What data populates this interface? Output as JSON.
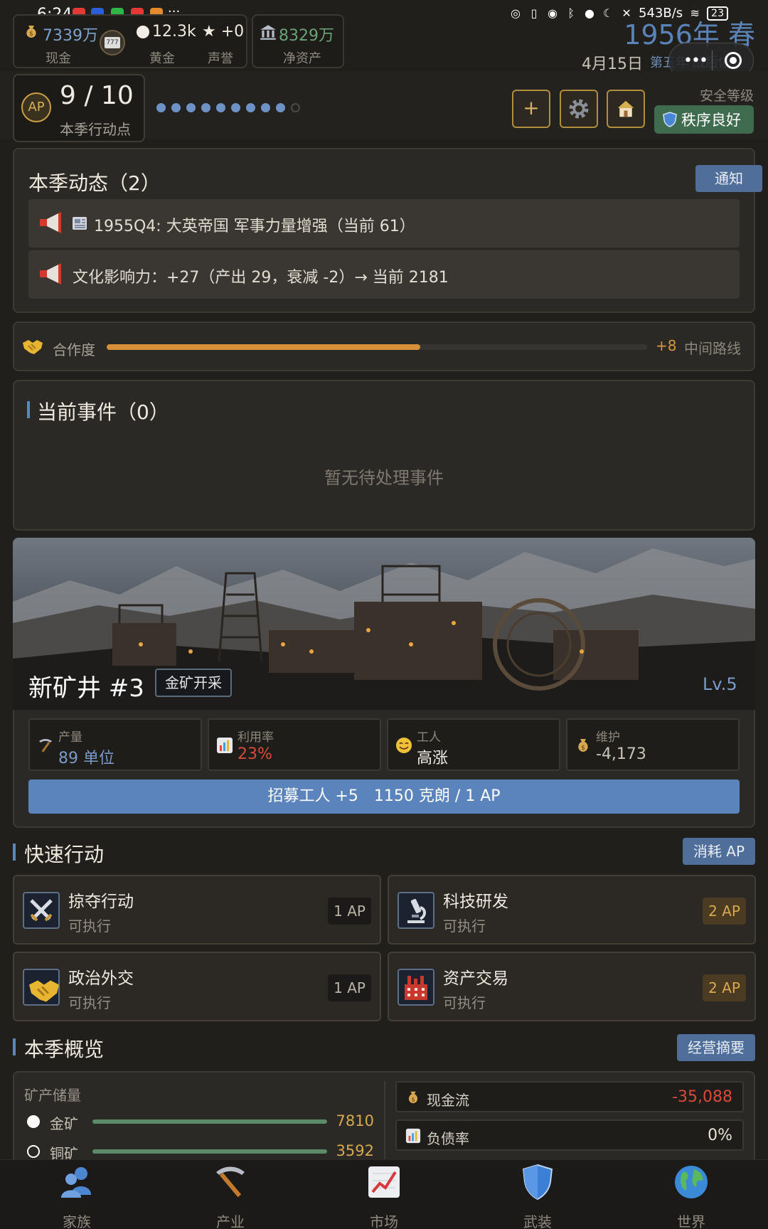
{
  "status_bar": {
    "time": "6:24",
    "net_speed": "543B/s",
    "battery": "23",
    "more": "···"
  },
  "resources": {
    "cash": {
      "value": "7339万",
      "label": "现金",
      "icon": "money-bag-icon"
    },
    "gold": {
      "value": "12.3k",
      "label": "黄金"
    },
    "prestige": {
      "value": "★ +0",
      "label": "声誉"
    },
    "net_assets": {
      "value": "8329万",
      "label": "净资产",
      "icon": "bank-icon"
    }
  },
  "date": {
    "year_season": "1956年 春",
    "day": "4月15日",
    "era": "第五年 战后恢"
  },
  "action_points": {
    "badge": "AP",
    "value": "9 / 10",
    "label": "本季行动点",
    "filled": 9,
    "total": 10
  },
  "toolbar": {
    "add_label": "+",
    "settings_icon": "gear-icon",
    "home_icon": "house-icon"
  },
  "safety": {
    "label": "安全等级",
    "badge": "秩序良好"
  },
  "dynamics": {
    "title": "本季动态（2）",
    "button": "通知",
    "items": [
      {
        "text": "1955Q4: 大英帝国 军事力量增强（当前 61）",
        "has_news_icon": true
      },
      {
        "text": "文化影响力：+27（产出 29，衰减 -2）→ 当前 2181",
        "has_news_icon": false
      }
    ]
  },
  "cooperation": {
    "label": "合作度",
    "level": 0.58,
    "delta": "+8",
    "route": "中间路线",
    "color": "#d6903a"
  },
  "events": {
    "title": "当前事件（0）",
    "empty": "暂无待处理事件"
  },
  "mine": {
    "name": "新矿井 #3",
    "tag": "金矿开采",
    "level": "Lv.5",
    "stats": [
      {
        "label": "产量",
        "value": "89 单位",
        "color": "#7a9bc8",
        "icon": "pickaxe-icon"
      },
      {
        "label": "利用率",
        "value": "23%",
        "color": "#d84a3a",
        "icon": "bar-chart-icon"
      },
      {
        "label": "工人",
        "value": "高涨",
        "color": "#f2ede4",
        "icon": "smile-icon"
      },
      {
        "label": "维护",
        "value": "-4,173",
        "color": "#c8c2b6",
        "icon": "money-bag-icon"
      }
    ],
    "recruit": "招募工人 +5　1150 克朗 / 1 AP"
  },
  "quick_actions": {
    "title": "快速行动",
    "button": "消耗 AP",
    "items": [
      {
        "name": "掠夺行动",
        "state": "可执行",
        "cost": "1 AP",
        "icon": "crossed-swords-icon"
      },
      {
        "name": "科技研发",
        "state": "可执行",
        "cost": "2 AP",
        "icon": "microscope-icon"
      },
      {
        "name": "政治外交",
        "state": "可执行",
        "cost": "1 AP",
        "icon": "handshake-icon"
      },
      {
        "name": "资产交易",
        "state": "可执行",
        "cost": "2 AP",
        "icon": "factory-icon"
      }
    ]
  },
  "overview": {
    "title": "本季概览",
    "button": "经营摘要",
    "reserves_label": "矿产储量",
    "reserves": [
      {
        "name": "金矿",
        "value": "7810"
      },
      {
        "name": "铜矿",
        "value": "3592"
      }
    ],
    "metrics": [
      {
        "key": "现金流",
        "value": "-35,088",
        "color": "#d84a3a",
        "icon": "money-bag-icon"
      },
      {
        "key": "负债率",
        "value": "0%",
        "color": "#e8e2d6",
        "icon": "bar-chart-icon"
      }
    ]
  },
  "nav": [
    {
      "label": "家族",
      "icon": "family-icon"
    },
    {
      "label": "产业",
      "icon": "pickaxe-icon"
    },
    {
      "label": "市场",
      "icon": "chart-up-icon"
    },
    {
      "label": "武装",
      "icon": "shield-icon"
    },
    {
      "label": "世界",
      "icon": "globe-icon"
    }
  ]
}
